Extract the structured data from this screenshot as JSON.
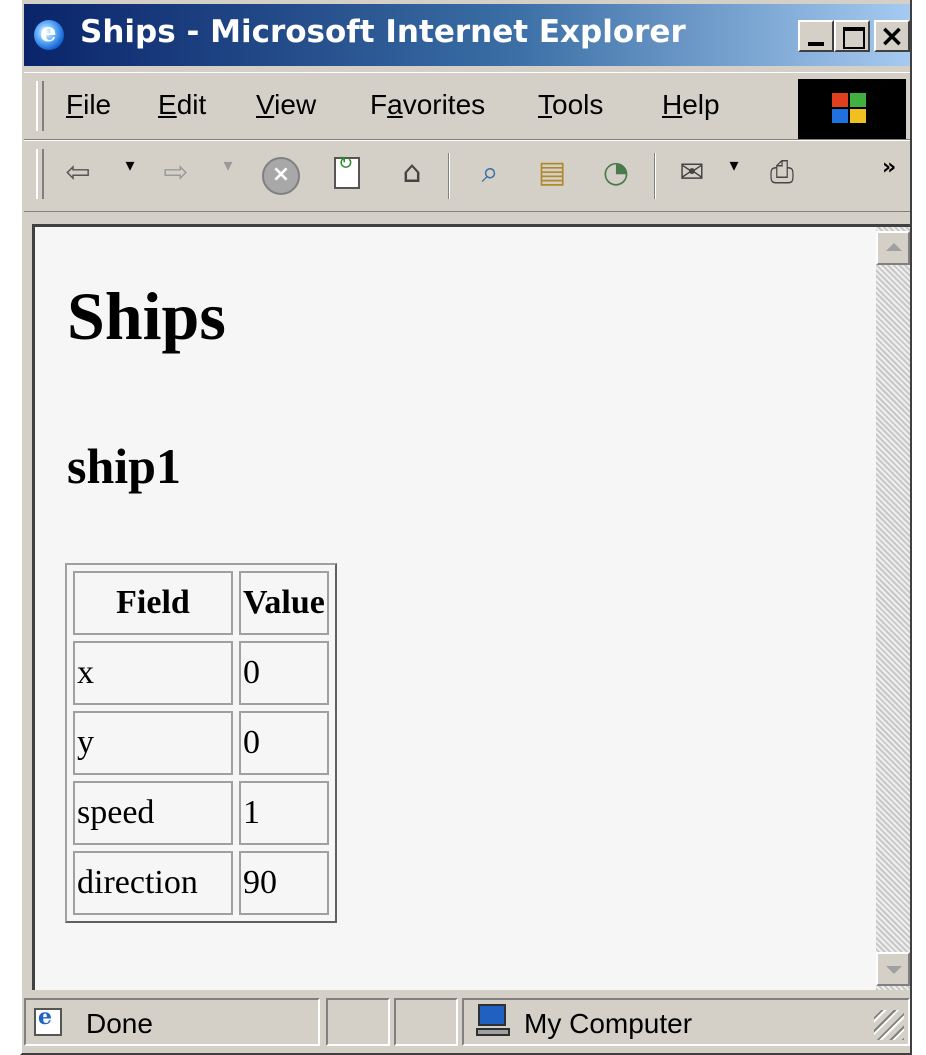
{
  "window": {
    "title": "Ships - Microsoft Internet Explorer"
  },
  "menubar": {
    "items": [
      {
        "hot": "F",
        "rest": "ile"
      },
      {
        "hot": "E",
        "rest": "dit"
      },
      {
        "hot": "V",
        "rest": "iew"
      },
      {
        "pre": "F",
        "hot": "a",
        "rest": "vorites"
      },
      {
        "hot": "T",
        "rest": "ools"
      },
      {
        "hot": "H",
        "rest": "elp"
      }
    ]
  },
  "toolbar": {
    "icons": [
      "back-icon",
      "forward-icon",
      "stop-icon",
      "refresh-icon",
      "home-icon",
      "search-icon",
      "favorites-icon",
      "history-icon",
      "mail-icon",
      "print-icon"
    ],
    "overflow": "»"
  },
  "page": {
    "heading": "Ships",
    "subheading": "ship1",
    "table": {
      "headers": [
        "Field",
        "Value"
      ],
      "rows": [
        [
          "x",
          "0"
        ],
        [
          "y",
          "0"
        ],
        [
          "speed",
          "1"
        ],
        [
          "direction",
          "90"
        ]
      ]
    }
  },
  "statusbar": {
    "status": "Done",
    "zone": "My Computer"
  },
  "colors": {
    "titlebar_start": "#0a246a",
    "titlebar_end": "#a6caf0",
    "chrome": "#d4d0c8"
  }
}
